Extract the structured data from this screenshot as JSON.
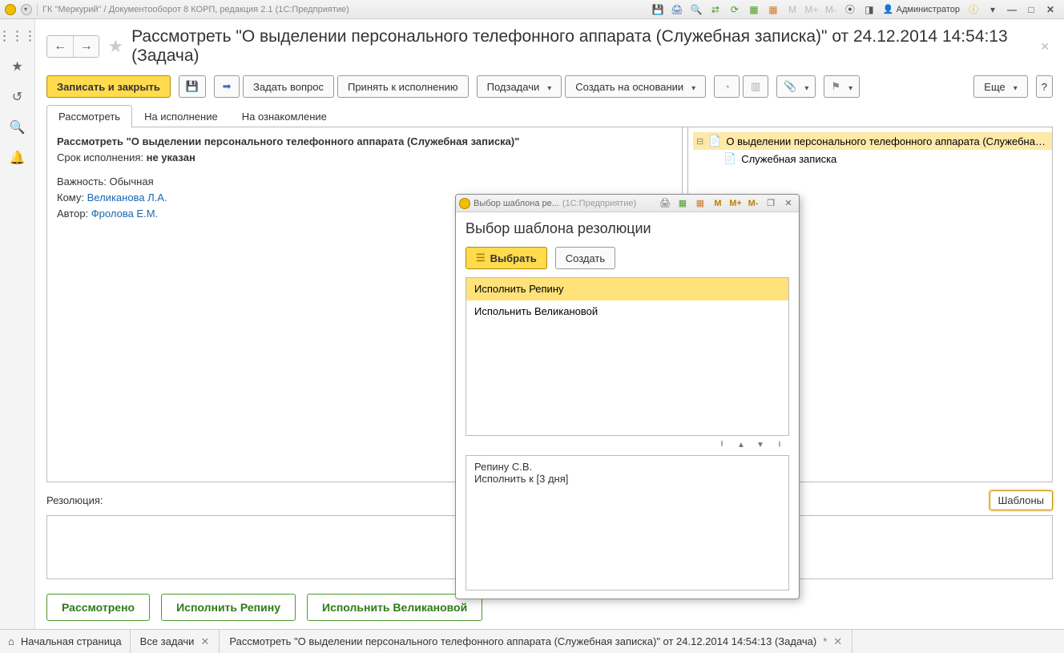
{
  "titlebar": {
    "app_title": "ГК \"Меркурий\" / Документооборот 8 КОРП, редакция 2.1  (1С:Предприятие)",
    "user": "Администратор",
    "m_labels": [
      "M",
      "M+",
      "M-"
    ]
  },
  "page": {
    "title": "Рассмотреть \"О выделении персонального телефонного аппарата (Служебная записка)\" от 24.12.2014 14:54:13 (Задача)"
  },
  "toolbar": {
    "save_close": "Записать и закрыть",
    "ask_question": "Задать вопрос",
    "accept_exec": "Принять к исполнению",
    "subtasks": "Подзадачи",
    "create_based": "Создать на основании",
    "more": "Еще",
    "help": "?"
  },
  "tabs": {
    "items": [
      "Рассмотреть",
      "На исполнение",
      "На ознакомление"
    ],
    "active_index": 0
  },
  "task": {
    "subject": "Рассмотреть \"О выделении персонального телефонного аппарата (Служебная записка)\"",
    "deadline_label": "Срок исполнения:",
    "deadline_value": "не указан",
    "importance_label": "Важность:",
    "importance_value": "Обычная",
    "to_label": "Кому:",
    "to_value": "Великанова Л.А.",
    "author_label": "Автор:",
    "author_value": "Фролова Е.М."
  },
  "tree": {
    "doc": "О выделении персонального телефонного аппарата (Служебная записка)",
    "attachment": "Служебная записка"
  },
  "resolution": {
    "label": "Резолюция:",
    "templates_btn": "Шаблоны"
  },
  "actions": {
    "reviewed": "Рассмотрено",
    "exec_repinu": "Исполнить Репину",
    "exec_velikanovoy": "Испольнить Великановой"
  },
  "bottom_tabs": {
    "home": "Начальная страница",
    "all_tasks": "Все задачи",
    "current": "Рассмотреть \"О выделении персонального телефонного аппарата (Служебная записка)\" от 24.12.2014 14:54:13 (Задача)"
  },
  "modal": {
    "window_title_left": "Выбор шаблона ре...",
    "window_title_mid": "(1С:Предприятие)",
    "m_labels": [
      "M",
      "M+",
      "M-"
    ],
    "heading": "Выбор шаблона резолюции",
    "choose": "Выбрать",
    "create": "Создать",
    "items": [
      "Исполнить Репину",
      "Испольнить Великановой"
    ],
    "selected_index": 0,
    "preview": "Репину С.В.\nИсполнить к [3 дня]"
  }
}
